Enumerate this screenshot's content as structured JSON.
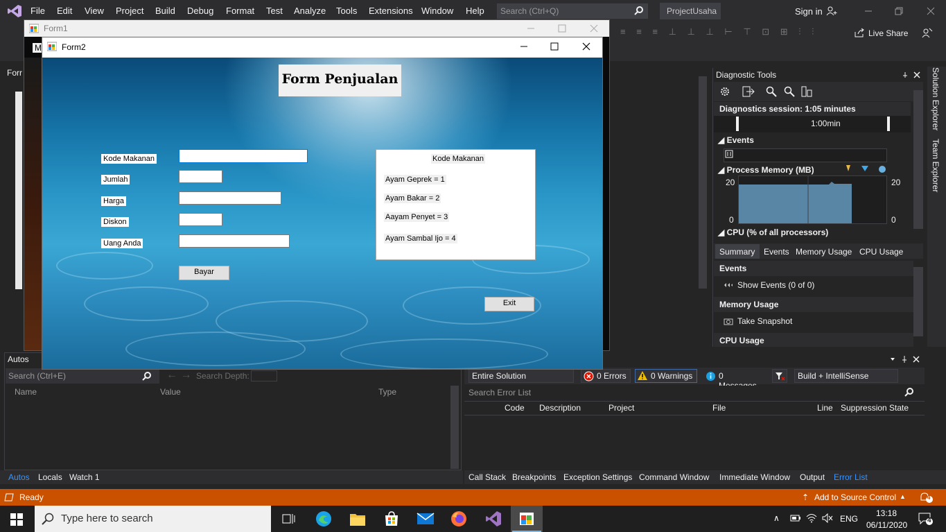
{
  "vs": {
    "menu": [
      "File",
      "Edit",
      "View",
      "Project",
      "Build",
      "Debug",
      "Format",
      "Test",
      "Analyze",
      "Tools",
      "Extensions",
      "Window",
      "Help"
    ],
    "search_placeholder": "Search (Ctrl+Q)",
    "project_name": "ProjectUsaha",
    "sign_in": "Sign in",
    "live_share": "Live Share",
    "designer_tab": "Forr"
  },
  "diagnostics": {
    "title": "Diagnostic Tools",
    "session": "Diagnostics session: 1:05 minutes",
    "timeline_label": "1:00min",
    "events_header": "Events",
    "process_memory_header": "Process Memory (MB)",
    "mem_max_left": "20",
    "mem_min_left": "0",
    "mem_max_right": "20",
    "mem_min_right": "0",
    "cpu_header": "CPU (% of all processors)",
    "tabs": [
      "Summary",
      "Events",
      "Memory Usage",
      "CPU Usage"
    ],
    "summary_events_h": "Events",
    "show_events": "Show Events (0 of 0)",
    "memory_usage_h": "Memory Usage",
    "take_snapshot": "Take Snapshot",
    "cpu_usage_h": "CPU Usage"
  },
  "side_tabs": [
    "Solution Explorer",
    "Team Explorer"
  ],
  "autos": {
    "title": "Autos",
    "search_placeholder": "Search (Ctrl+E)",
    "search_depth": "Search Depth:",
    "columns": [
      "Name",
      "Value",
      "Type"
    ],
    "tabs": [
      "Autos",
      "Locals",
      "Watch 1"
    ]
  },
  "errors": {
    "scope": "Entire Solution",
    "errors": "0 Errors",
    "warnings": "0 Warnings",
    "messages": "0 Messages",
    "build_filter": "Build + IntelliSense",
    "search_placeholder": "Search Error List",
    "columns": [
      "Code",
      "Description",
      "Project",
      "File",
      "Line",
      "Suppression State"
    ],
    "tabs": [
      "Call Stack",
      "Breakpoints",
      "Exception Settings",
      "Command Window",
      "Immediate Window",
      "Output",
      "Error List"
    ]
  },
  "status": {
    "ready": "Ready",
    "add_source": "Add to Source Control",
    "notifications": "4"
  },
  "taskbar": {
    "search_placeholder": "Type here to search",
    "lang": "ENG",
    "time": "13:18",
    "date": "06/11/2020",
    "notif": "4"
  },
  "form1": {
    "title": "Form1"
  },
  "form2": {
    "title": "Form2",
    "heading": "Form Penjualan",
    "labels": {
      "kode": "Kode Makanan",
      "jumlah": "Jumlah",
      "harga": "Harga",
      "diskon": "Diskon",
      "uang": "Uang Anda"
    },
    "bayar": "Bayar",
    "exit": "Exit",
    "info": {
      "title": "Kode Makanan",
      "item1": "Ayam Geprek = 1",
      "item2": "Ayam Bakar = 2",
      "item3": "Aayam Penyet = 3",
      "item4": "Ayam Sambal Ijo = 4"
    }
  }
}
